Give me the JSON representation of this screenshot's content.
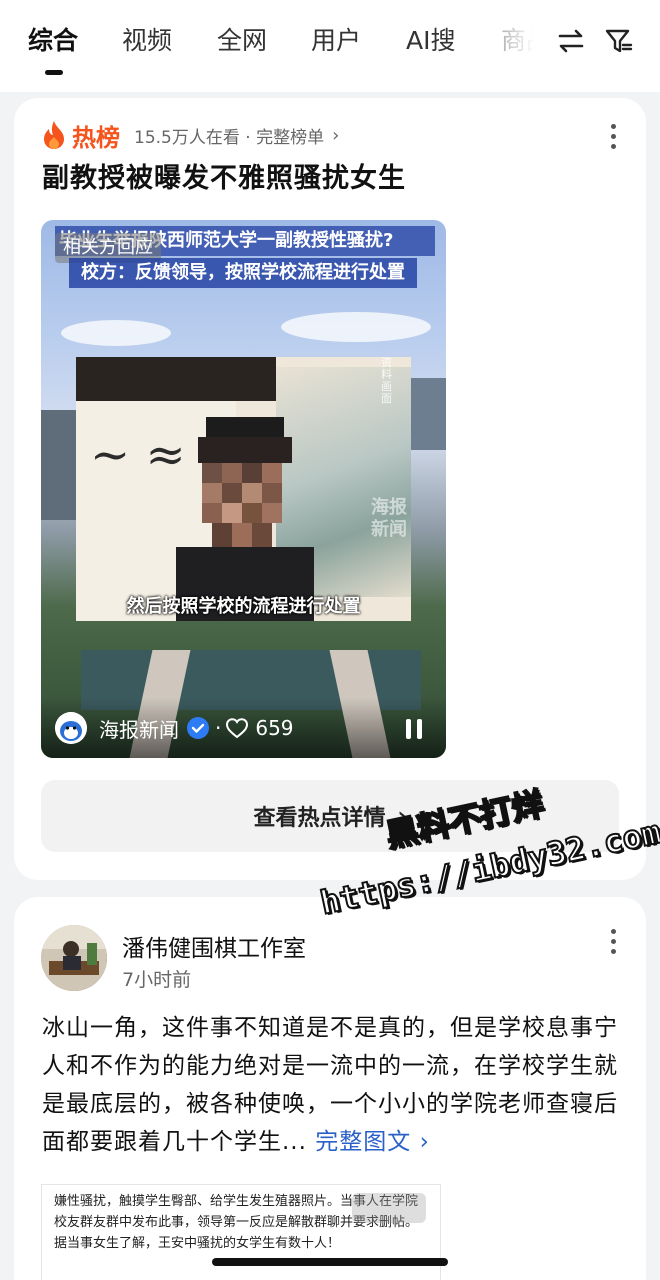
{
  "tabs": [
    {
      "label": "综合",
      "active": true
    },
    {
      "label": "视频"
    },
    {
      "label": "全网"
    },
    {
      "label": "用户"
    },
    {
      "label": "AI搜"
    },
    {
      "label": "商品"
    }
  ],
  "top_icons": [
    "switch-arrows-icon",
    "filter-icon"
  ],
  "hot_card": {
    "badge": "热榜",
    "meta": "15.5万人在看 · 完整榜单",
    "chevron": "›",
    "headline": "副教授被曝发不雅照骚扰女生",
    "video": {
      "title_line1": "毕业生举报陕西师范大学一副教授性骚扰?",
      "title_line2": "校方：反馈领导，按照学校流程进行处置",
      "tag": "相关方回应",
      "side_text": "资料画面",
      "inset_watermark": "海报新闻",
      "subtitle": "然后按照学校的流程进行处置",
      "source": "海报新闻",
      "separator": "·",
      "likes": "659"
    },
    "detail_button": "查看热点详情",
    "detail_chevron": "›",
    "accent": "#f5541c"
  },
  "post": {
    "author": "潘伟健围棋工作室",
    "time": "7小时前",
    "body": "冰山一角，这件事不知道是不是真的，但是学校息事宁人和不作为的能力绝对是一流中的一流，在学校学生就是最底层的，被各种使唤，一个小小的学院老师查寝后面都要跟着几十个学生...",
    "full_link": "完整图文",
    "full_link_chevron": "›",
    "quote_text": "嫌性骚扰，触摸学生臀部、给学生发生殖器照片。当事人在学院校友群友群中发布此事，领导第一反应是解散群聊并要求删帖。据当事女生了解，王安中骚扰的女学生有数十人！",
    "link_color": "#2a61c7"
  },
  "watermark": {
    "line1": "黑料不打烊",
    "line2": "https://ibdy32.com"
  }
}
